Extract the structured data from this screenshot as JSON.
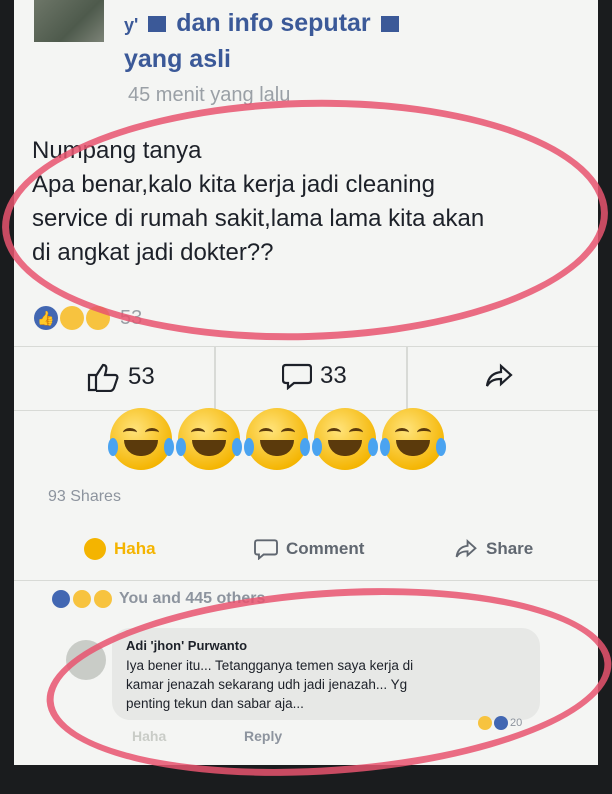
{
  "post": {
    "group_name_part1": "dan info seputar",
    "group_name_part2": "yang asli",
    "timestamp": "45 menit yang lalu",
    "text_lines": [
      "Numpang tanya",
      "Apa benar,kalo kita kerja jadi cleaning",
      "service di rumah sakit,lama lama kita akan",
      "di angkat jadi dokter??"
    ],
    "reaction_count": "53"
  },
  "action_bar": {
    "like_count": "53",
    "comment_count": "33"
  },
  "emoji_reply_count": 5,
  "shares": "93 Shares",
  "actions": {
    "haha_label": "Haha",
    "comment_label": "Comment",
    "share_label": "Share"
  },
  "liked_by": "You and 445 others",
  "comment": {
    "author": "Adi 'jhon' Purwanto",
    "lines": [
      "Iya bener itu... Tetangganya temen saya kerja di",
      "kamar jenazah sekarang udh jadi jenazah... Yg",
      "penting tekun dan sabar aja..."
    ],
    "reaction_count": "20",
    "reply_label": "Reply",
    "faded_label": "Haha"
  },
  "colors": {
    "annotation": "#e8546e",
    "link_blue": "#3b5998",
    "haha_yellow": "#f4b400"
  },
  "icons": [
    "thumbs-up-icon",
    "comment-bubble-icon",
    "share-arrow-icon",
    "laughing-tears-emoji"
  ]
}
